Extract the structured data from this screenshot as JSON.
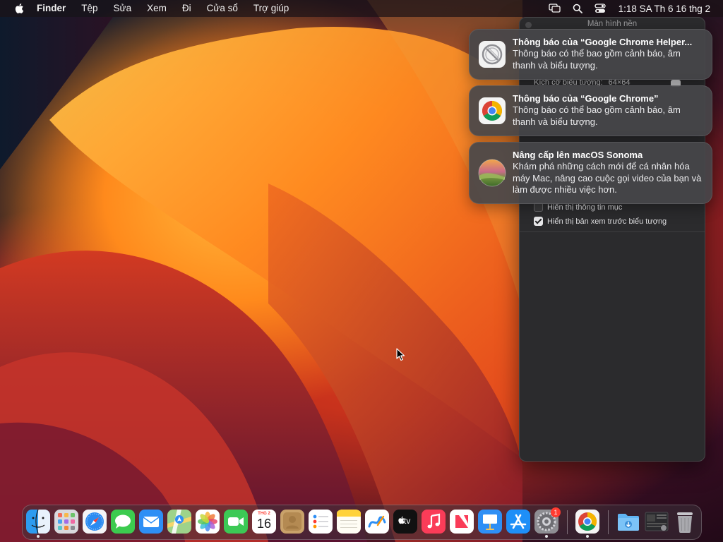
{
  "menubar": {
    "app_name": "Finder",
    "items": [
      "Tệp",
      "Sửa",
      "Xem",
      "Đi",
      "Cửa sổ",
      "Trợ giúp"
    ],
    "clock": "1:18 SA Th 6 16 thg 2",
    "status_icons": [
      "screen-mirroring-icon",
      "search-icon",
      "control-center-icon"
    ]
  },
  "window": {
    "title": "Màn hình nền",
    "icon_size_label": "Kích cỡ biểu tượng:",
    "icon_size_value": "64×64",
    "checkboxes": [
      {
        "label": "Hiển thị thông tin mục",
        "checked": false
      },
      {
        "label": "Hiển thị bản xem trước biểu tượng",
        "checked": true
      }
    ]
  },
  "notifications": [
    {
      "title": "Thông báo của “Google Chrome Helper...",
      "body": "Thông báo có thể bao gồm cảnh báo, âm thanh và biểu tượng.",
      "icon": "chrome-helper-icon"
    },
    {
      "title": "Thông báo của “Google Chrome”",
      "body": "Thông báo có thể bao gồm cảnh báo, âm thanh và biểu tượng.",
      "icon": "chrome-icon"
    },
    {
      "title": "Nâng cấp lên macOS Sonoma",
      "body": "Khám phá những cách mới để cá nhân hóa máy Mac, nâng cao cuộc gọi video của bạn và làm được nhiều việc hơn.",
      "icon": "macos-sonoma-icon"
    }
  ],
  "dock": {
    "calendar_month": "THG 2",
    "calendar_day": "16",
    "tv_label": "tv",
    "settings_badge": "1",
    "apps": [
      "finder",
      "launchpad",
      "safari",
      "messages",
      "mail",
      "maps",
      "photos",
      "facetime",
      "calendar",
      "contacts",
      "reminders",
      "notes",
      "freeform",
      "tv",
      "music",
      "news",
      "keynote",
      "app-store",
      "system-settings",
      "chrome",
      "downloads",
      "recent-window",
      "trash"
    ]
  }
}
